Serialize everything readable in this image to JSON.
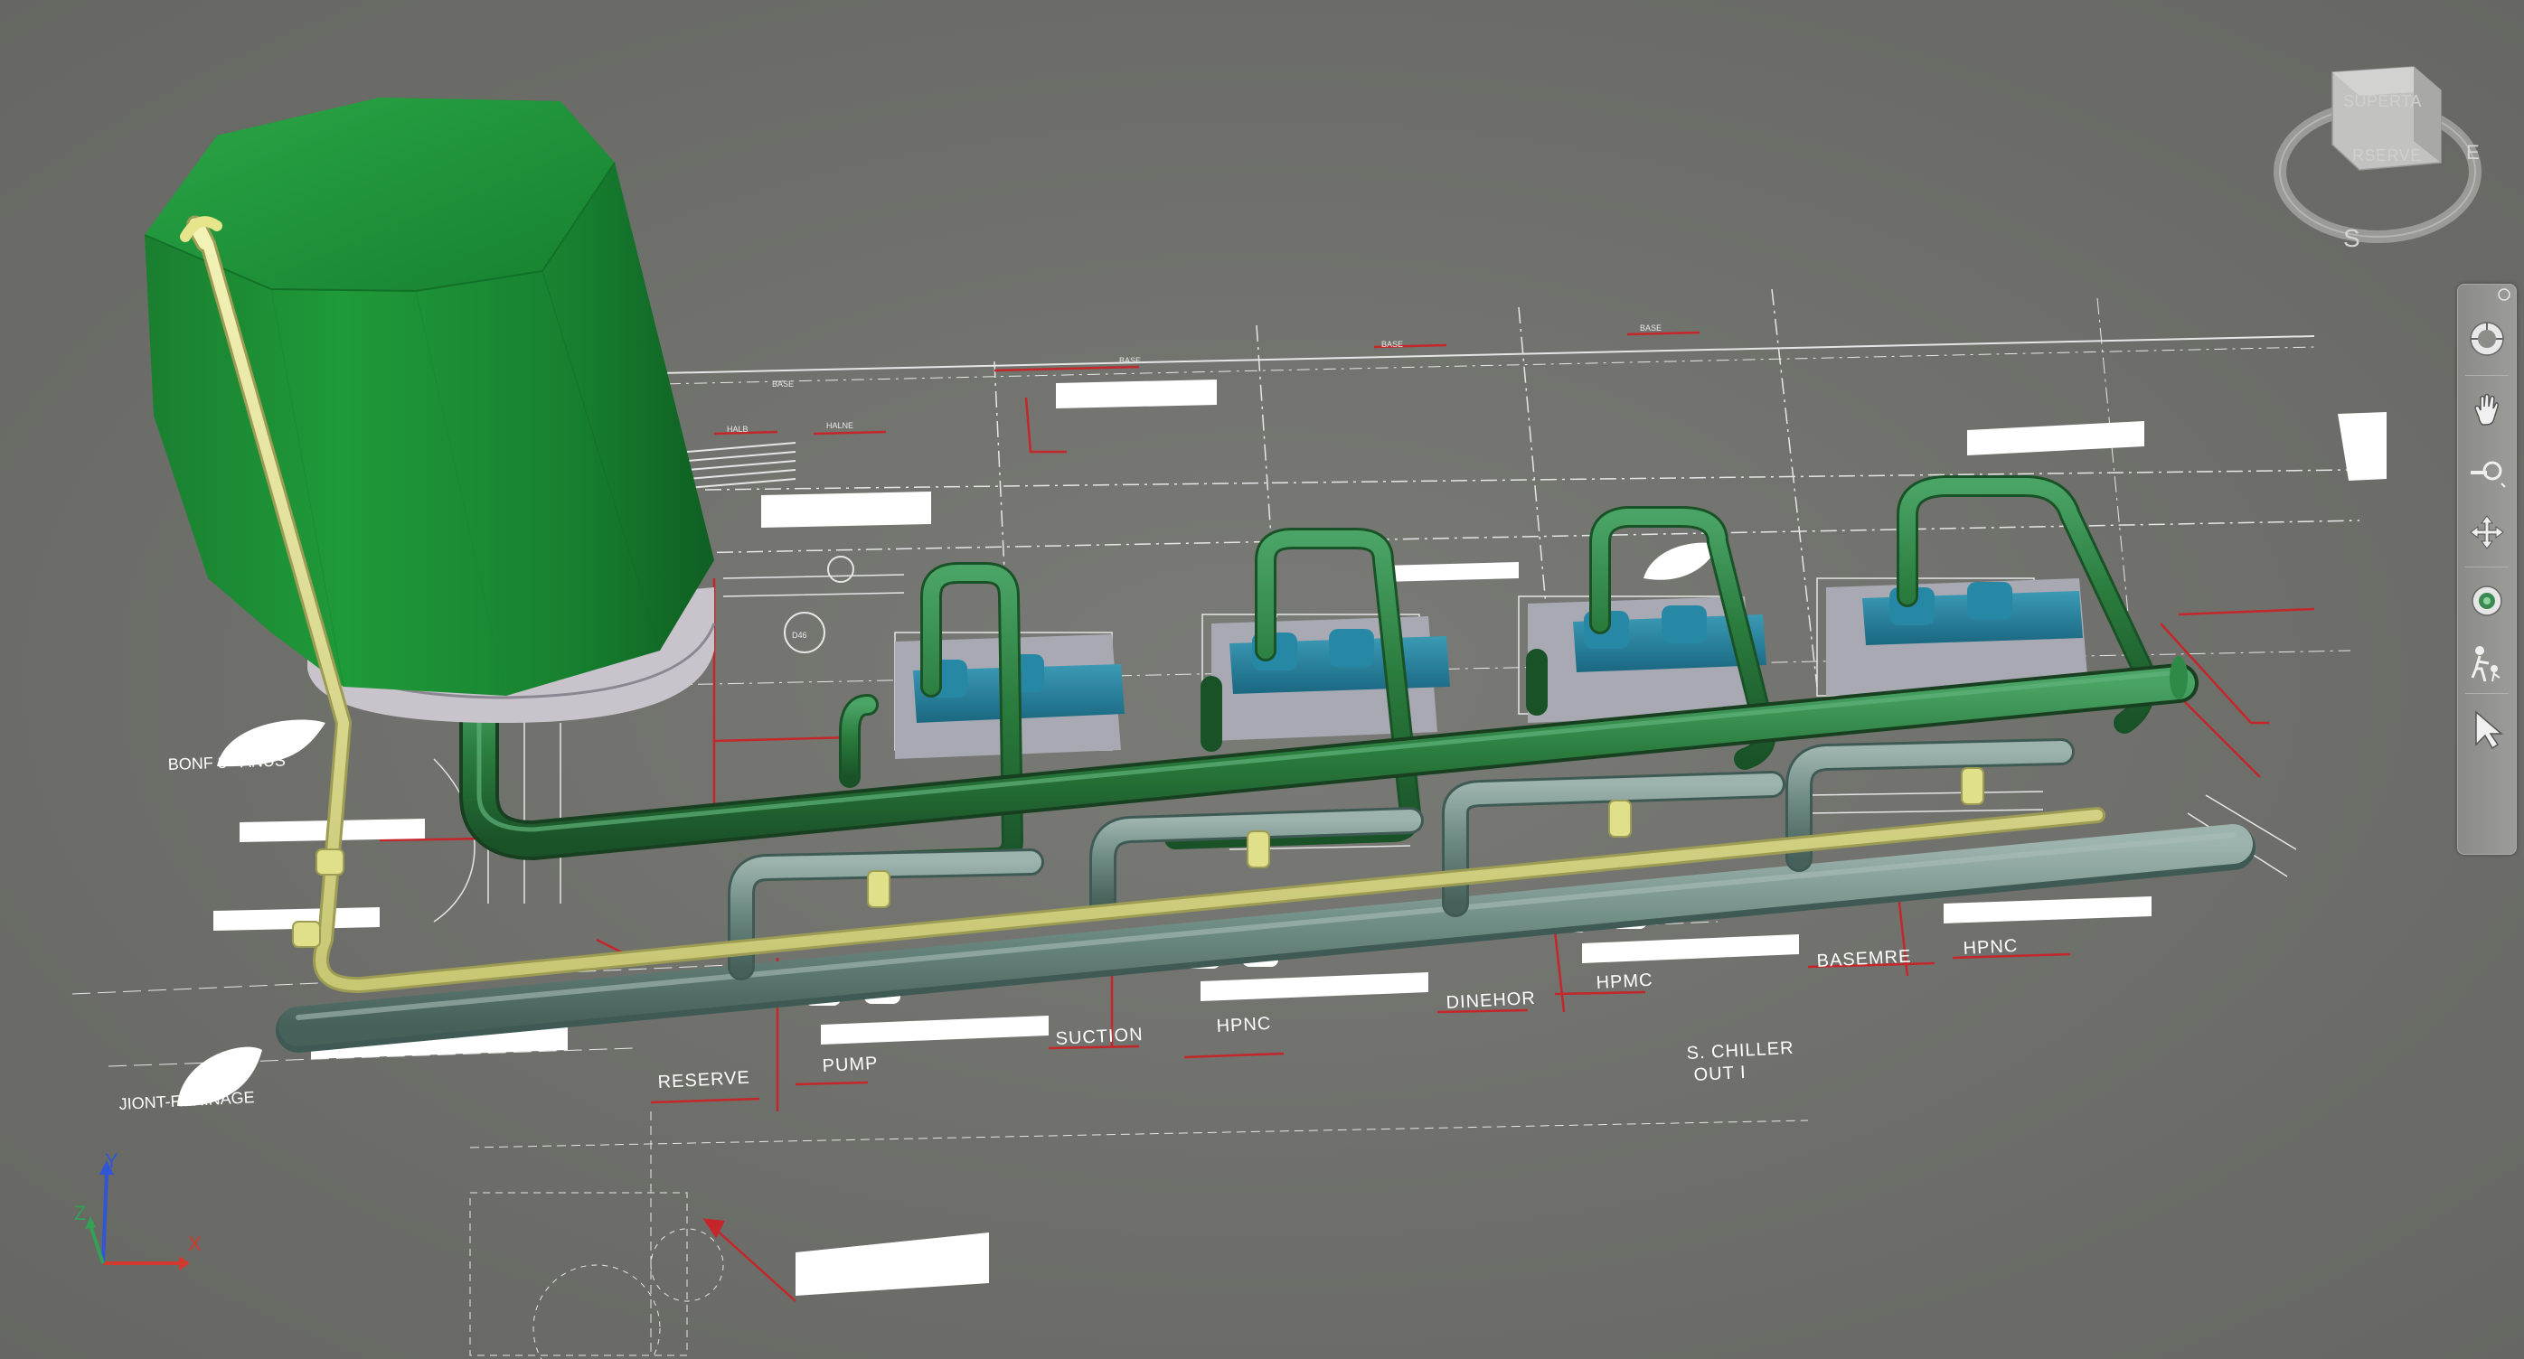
{
  "viewcube": {
    "top_label": "SUPERTA",
    "front_label": "RSERVE",
    "compass_south": "S",
    "compass_east": "E"
  },
  "triad": {
    "x": "X",
    "y": "Y",
    "z": "Z"
  },
  "colors": {
    "background": "#6f706b",
    "tank": "#1e8a36",
    "main_pipe": "#2b7a3c",
    "return_pipe": "#6f8f86",
    "aux_pipe": "#e3e38a",
    "pump_unit": "#1f7a96",
    "annotation_red": "#c4262a",
    "drawing_lines": "#e8e8e8"
  },
  "navbar": {
    "icons": [
      "steering-wheel-icon",
      "pan-hand-icon",
      "zoom-icon",
      "orbit-icon",
      "center-icon",
      "walk-icon",
      "select-arrow-icon"
    ]
  },
  "drawing": {
    "labels": {
      "bonf": "BONF 3 - ANUS",
      "jiont": "JIONT-F...RINAGE",
      "reserve": "RESERVE",
      "pump": "PUMP",
      "suction": "SUCTION",
      "hpnc_1": "HPNC",
      "dinehor": "DINEHOR",
      "hpmc": "HPMC",
      "basemre": "BASEMRE",
      "hpnc_2": "HPNC",
      "chiller_1": "S. CHILLER",
      "chiller_2": "OUT I",
      "halb": "HALB",
      "halne": "HALNE",
      "base_1": "BASE",
      "base_2": "BASE",
      "base_3": "BASE",
      "base_4": "BASE",
      "d46": "D46"
    }
  }
}
